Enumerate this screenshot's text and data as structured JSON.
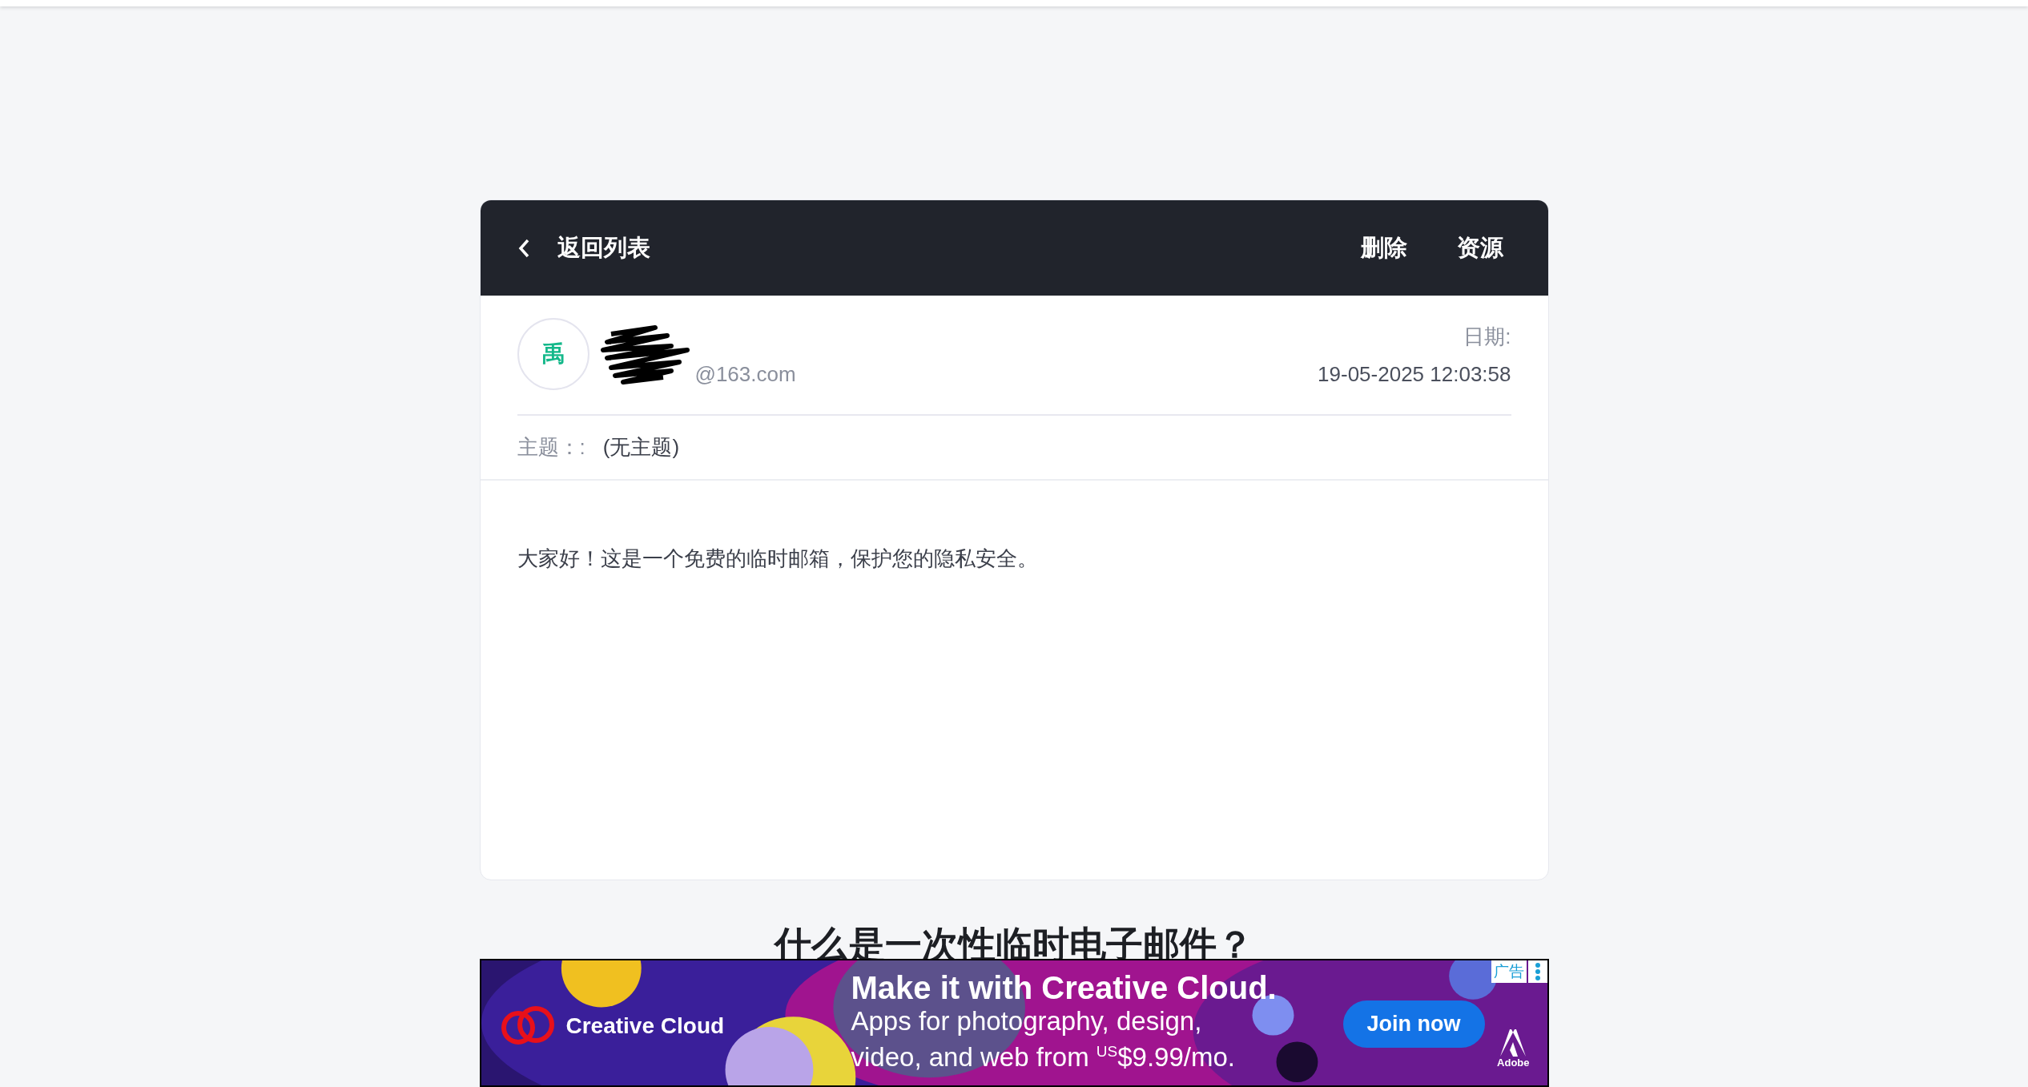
{
  "header": {
    "back_label": "返回列表",
    "actions": [
      "删除",
      "资源"
    ]
  },
  "sender": {
    "avatar_letter": "禹",
    "address": "@163.com",
    "date_label": "日期:",
    "date": "19-05-2025 12:03:58"
  },
  "subject": {
    "label": "主题：:",
    "value": "(无主题)"
  },
  "body": "大家好！这是一个免费的临时邮箱，保护您的隐私安全。",
  "section_heading": "什么是一次性临时电子邮件？",
  "ad": {
    "badge": "广告",
    "brand": "Creative Cloud",
    "headline": "Make it with Creative Cloud.",
    "line_1": "Apps for photography, design,",
    "line_2": "video, and web from ",
    "price_prefix": "US",
    "price": "$9.99/mo.",
    "button": "Join now",
    "maker": "Adobe"
  }
}
